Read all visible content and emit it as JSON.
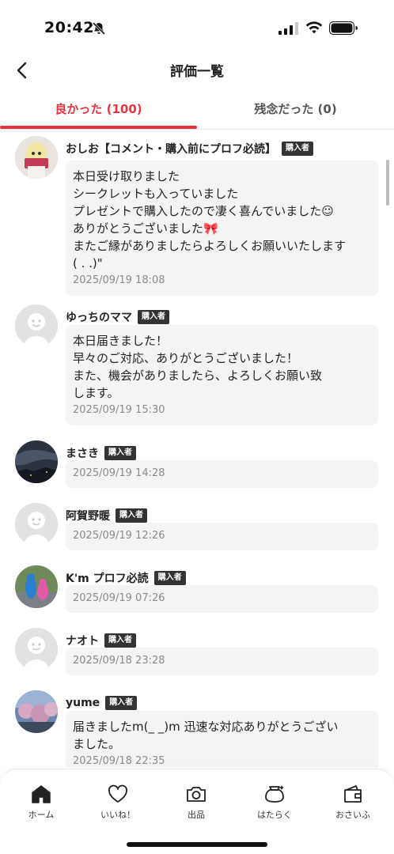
{
  "status_bar": {
    "time": "20:42"
  },
  "header": {
    "title": "評価一覧"
  },
  "tabs": [
    {
      "label": "良かった (100)",
      "active": true
    },
    {
      "label": "残念だった (0)",
      "active": false
    }
  ],
  "badge_label": "購入者",
  "reviews": [
    {
      "name": "おしお【コメント・購入前にプロフ必読】",
      "comment": "本日受け取りました\nシークレットも入っていました\nプレゼントで購入したので凄く喜んでいました☺︎\nありがとうございました🎀\nまたご縁がありましたらよろしくお願いいたします\n(  . .)\"",
      "date": "2025/09/19 18:08"
    },
    {
      "name": "ゆっちのママ",
      "comment": "本日届きました！\n早々のご対応、ありがとうございました！\nまた、機会がありましたら、よろしくお願い致\nします。",
      "date": "2025/09/19 15:30"
    },
    {
      "name": "まさき",
      "comment": "",
      "date": "2025/09/19 14:28"
    },
    {
      "name": "阿賀野暖",
      "comment": "",
      "date": "2025/09/19 12:26"
    },
    {
      "name": "K'm プロフ必読",
      "comment": "",
      "date": "2025/09/19 07:26"
    },
    {
      "name": "ナオト",
      "comment": "",
      "date": "2025/09/18 23:28"
    },
    {
      "name": "yume",
      "comment": "届きましたm(_ _)m 迅速な対応ありがとうござい\nました。",
      "date": "2025/09/18 22:35"
    }
  ],
  "nav": [
    {
      "label": "ホーム",
      "icon": "home-icon"
    },
    {
      "label": "いいね！",
      "icon": "heart-icon"
    },
    {
      "label": "出品",
      "icon": "camera-icon"
    },
    {
      "label": "はたらく",
      "icon": "work-icon"
    },
    {
      "label": "おさいふ",
      "icon": "wallet-icon"
    }
  ],
  "colors": {
    "accent": "#e8333f",
    "badge": "#333333",
    "bubble": "#f4f4f4"
  }
}
